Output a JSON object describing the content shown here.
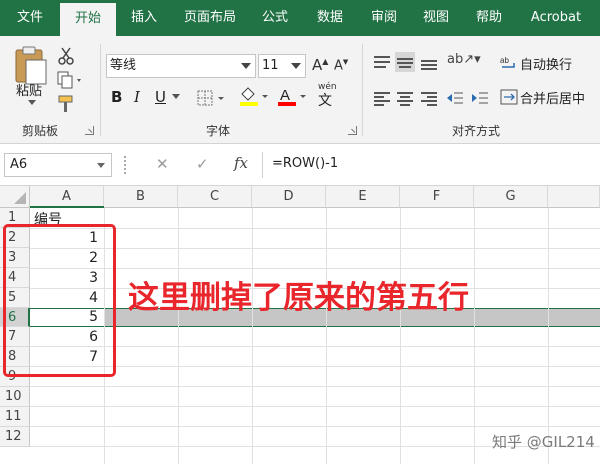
{
  "ribbon": {
    "tabs": [
      "文件",
      "开始",
      "插入",
      "页面布局",
      "公式",
      "数据",
      "审阅",
      "视图",
      "帮助",
      "Acrobat"
    ],
    "active_tab": "开始",
    "clipboard": {
      "paste_label": "粘贴",
      "group_label": "剪贴板"
    },
    "font": {
      "font_name": "等线",
      "font_size": "11",
      "group_label": "字体",
      "phonetic_label": "wén"
    },
    "alignment": {
      "wrap_text": "自动换行",
      "merge_center": "合并后居中",
      "group_label": "对齐方式"
    },
    "colors": {
      "brand": "#217346",
      "highlight": "#ffff00",
      "font_color": "#ff0000"
    }
  },
  "formula_bar": {
    "name_box": "A6",
    "cancel_glyph": "✕",
    "enter_glyph": "✓",
    "fx_label": "fx",
    "formula": "=ROW()-1"
  },
  "sheet": {
    "columns": [
      "A",
      "B",
      "C",
      "D",
      "E",
      "F",
      "G"
    ],
    "rows": [
      "1",
      "2",
      "3",
      "4",
      "5",
      "6",
      "7",
      "8",
      "9",
      "10",
      "11",
      "12"
    ],
    "header_cell": "编号",
    "values": [
      "1",
      "2",
      "3",
      "4",
      "5",
      "6",
      "7"
    ],
    "selected_row": "6",
    "annotation": "这里删掉了原来的第五行",
    "annotation_color": "#e8262b"
  },
  "watermark": "知乎 @GIL214"
}
